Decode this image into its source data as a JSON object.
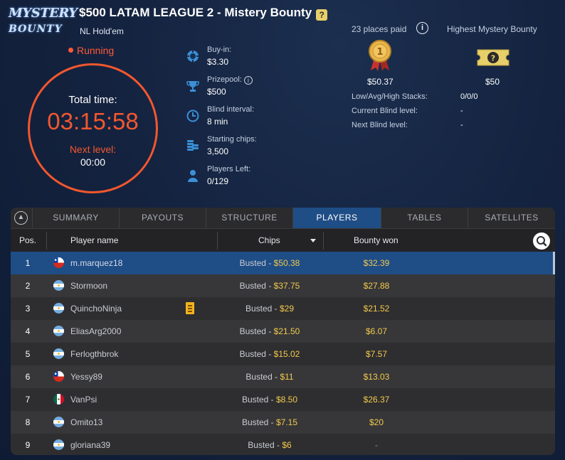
{
  "header": {
    "logo_line1": "MYSTERY",
    "logo_line2": "BOUNTY",
    "title": "$500 LATAM LEAGUE 2 - Mistery Bounty",
    "game_type": "NL Hold'em",
    "status": "Running"
  },
  "clock": {
    "total_label": "Total time:",
    "total_time": "03:15:58",
    "next_label": "Next level:",
    "next_time": "00:00"
  },
  "info": [
    {
      "label": "Buy-in:",
      "value": "$3.30",
      "icon": "chip-icon"
    },
    {
      "label": "Prizepool:",
      "value": "$500",
      "icon": "trophy-icon"
    },
    {
      "label": "Blind interval:",
      "value": "8 min",
      "icon": "clock-icon"
    },
    {
      "label": "Starting chips:",
      "value": "3,500",
      "icon": "chip-stack-icon"
    },
    {
      "label": "Players Left:",
      "value": "0/129",
      "icon": "player-icon"
    }
  ],
  "prizes": {
    "places_paid": "23 places paid",
    "highest_label": "Highest Mystery Bounty",
    "first_prize": "$50.37",
    "highest_bounty": "$50",
    "info_glyph": "i"
  },
  "stats": [
    {
      "label": "Low/Avg/High Stacks:",
      "value": "0/0/0"
    },
    {
      "label": "Current Blind level:",
      "value": "-"
    },
    {
      "label": "Next Blind level:",
      "value": "-"
    }
  ],
  "tabs": [
    "SUMMARY",
    "PAYOUTS",
    "STRUCTURE",
    "PLAYERS",
    "TABLES",
    "SATELLITES"
  ],
  "active_tab": "PLAYERS",
  "columns": {
    "pos": "Pos.",
    "player": "Player name",
    "chips": "Chips",
    "bounty": "Bounty won"
  },
  "players": [
    {
      "pos": "1",
      "flag": "CL",
      "name": "m.marquez18",
      "status": "Busted - ",
      "prize": "$50.38",
      "bounty": "$32.39"
    },
    {
      "pos": "2",
      "flag": "AR",
      "name": "Stormoon",
      "status": "Busted - ",
      "prize": "$37.75",
      "bounty": "$27.88"
    },
    {
      "pos": "3",
      "flag": "AR",
      "name": "QuinchoNinja",
      "status": "Busted - ",
      "prize": "$29",
      "bounty": "$21.52"
    },
    {
      "pos": "4",
      "flag": "AR",
      "name": "EliasArg2000",
      "status": "Busted - ",
      "prize": "$21.50",
      "bounty": "$6.07"
    },
    {
      "pos": "5",
      "flag": "AR",
      "name": "Ferlogthbrok",
      "status": "Busted - ",
      "prize": "$15.02",
      "bounty": "$7.57"
    },
    {
      "pos": "6",
      "flag": "CL",
      "name": "Yessy89",
      "status": "Busted - ",
      "prize": "$11",
      "bounty": "$13.03"
    },
    {
      "pos": "7",
      "flag": "MX",
      "name": "VanPsi",
      "status": "Busted - ",
      "prize": "$8.50",
      "bounty": "$26.37"
    },
    {
      "pos": "8",
      "flag": "AR",
      "name": "Omito13",
      "status": "Busted - ",
      "prize": "$7.15",
      "bounty": "$20"
    },
    {
      "pos": "9",
      "flag": "AR",
      "name": "gloriana39",
      "status": "Busted - ",
      "prize": "$6",
      "bounty": "-"
    }
  ],
  "colors": {
    "accent": "#f3572e",
    "selected": "#1f4d86",
    "gold": "#f2c94c"
  }
}
